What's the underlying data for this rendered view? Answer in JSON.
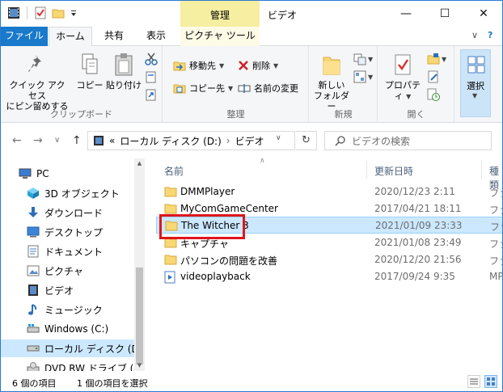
{
  "window": {
    "title": "ビデオ",
    "context_tab_header": "管理",
    "controls": {
      "minimize": "—",
      "maximize": "☐",
      "close": "✕"
    }
  },
  "ribbon_tabs": [
    {
      "label": "ファイル"
    },
    {
      "label": "ホーム"
    },
    {
      "label": "共有"
    },
    {
      "label": "表示"
    },
    {
      "label": "ピクチャ ツール"
    }
  ],
  "ribbon_misc": {
    "collapse": "∨",
    "help": "?"
  },
  "ribbon": {
    "clipboard": {
      "label": "クリップボード",
      "pin_line1": "クイック アクセス",
      "pin_line2": "にピン留めする",
      "copy": "コピー",
      "paste": "貼り付け"
    },
    "organize": {
      "label": "整理",
      "move_to": "移動先",
      "copy_to": "コピー先",
      "delete": "削除",
      "rename": "名前の変更"
    },
    "new": {
      "label": "新規",
      "new_folder_line1": "新しい",
      "new_folder_line2": "フォルダー"
    },
    "open": {
      "label": "開く",
      "properties": "プロパティ"
    },
    "select": {
      "label": "選択"
    }
  },
  "address": {
    "prefix": "«",
    "crumbs": [
      "ローカル ディスク (D:)",
      "ビデオ"
    ],
    "sep": "›",
    "search_placeholder": "ビデオの検索",
    "back": "←",
    "forward": "→",
    "recent": "∨",
    "up": "↑",
    "refresh": "↻",
    "dropdown": "∨"
  },
  "nav": {
    "items": [
      {
        "label": "PC",
        "icon": "pc-icon"
      },
      {
        "label": "3D オブジェクト",
        "icon": "3d-objects-icon"
      },
      {
        "label": "ダウンロード",
        "icon": "download-icon"
      },
      {
        "label": "デスクトップ",
        "icon": "desktop-icon"
      },
      {
        "label": "ドキュメント",
        "icon": "documents-icon"
      },
      {
        "label": "ピクチャ",
        "icon": "pictures-icon"
      },
      {
        "label": "ビデオ",
        "icon": "videos-icon"
      },
      {
        "label": "ミュージック",
        "icon": "music-icon"
      },
      {
        "label": "Windows (C:)",
        "icon": "drive-icon"
      },
      {
        "label": "ローカル ディスク (D:)",
        "icon": "drive-icon"
      },
      {
        "label": "DVD RW ドライブ (E:) A",
        "icon": "dvd-drive-icon"
      }
    ],
    "selected_index": 9
  },
  "files": {
    "columns": {
      "name": "名前",
      "date": "更新日時",
      "type": "種類"
    },
    "rows": [
      {
        "name": "DMMPlayer",
        "date": "2020/12/23 2:11",
        "type": "ファ",
        "kind": "folder"
      },
      {
        "name": "MyComGameCenter",
        "date": "2017/04/21 18:11",
        "type": "ファ",
        "kind": "folder"
      },
      {
        "name": "The Witcher 3",
        "date": "2021/01/09 23:33",
        "type": "ファ",
        "kind": "folder"
      },
      {
        "name": "キャプチャ",
        "date": "2021/01/08 23:49",
        "type": "ファ",
        "kind": "folder"
      },
      {
        "name": "パソコンの問題を改善",
        "date": "2020/12/20 21:56",
        "type": "ファ",
        "kind": "folder"
      },
      {
        "name": "videoplayback",
        "date": "2017/09/24 9:35",
        "type": "MP",
        "kind": "video"
      }
    ],
    "selected_index": 2
  },
  "status": {
    "count": "6 個の項目",
    "selected": "1 個の項目を選択"
  },
  "colors": {
    "accent": "#1979ca",
    "selection": "#cce8ff",
    "context_tab": "#f6eea0",
    "folder": "#f8d775",
    "highlight_box": "#e0161b"
  }
}
